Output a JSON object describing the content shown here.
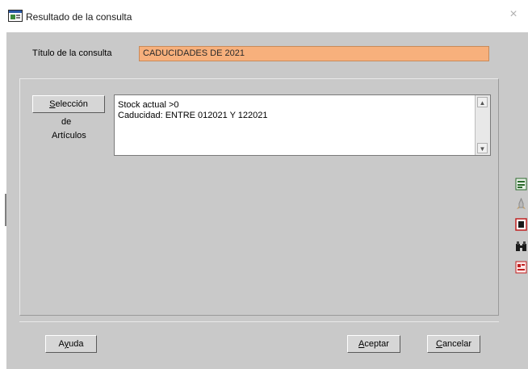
{
  "window": {
    "title": "Resultado de la consulta",
    "close_glyph": "×"
  },
  "query": {
    "title_label": "Título de la consulta",
    "title_value": "CADUCIDADES DE 2021"
  },
  "selection": {
    "button_accel": "S",
    "button_rest": "elección",
    "sub_line1": "de",
    "sub_line2": "Artículos",
    "lines": [
      "Stock actual >0",
      "Caducidad: ENTRE 012021 Y 122021"
    ]
  },
  "footer": {
    "help_accel": "y",
    "help_pre": "A",
    "help_post": "uda",
    "ok_accel": "A",
    "ok_rest": "ceptar",
    "cancel_accel": "C",
    "cancel_rest": "ancelar"
  },
  "toolbar_icons": [
    "edit-icon",
    "rocket-icon",
    "print-icon",
    "binoculars-icon",
    "report-icon"
  ]
}
